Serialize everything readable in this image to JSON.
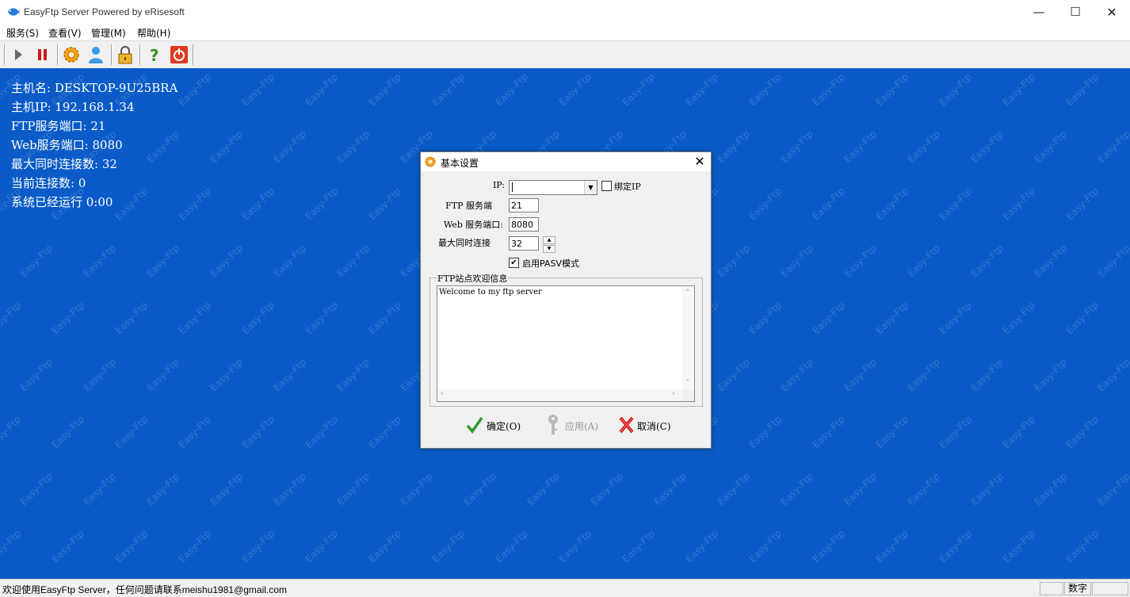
{
  "window": {
    "title": "EasyFtp Server Powered by eRisesoft",
    "min_glyph": "—",
    "max_glyph": "☐",
    "close_glyph": "✕"
  },
  "menu": [
    "服务(S)",
    "查看(V)",
    "管理(M)",
    "帮助(H)"
  ],
  "toolbar": {
    "icons": [
      "play-icon",
      "pause-icon",
      "settings-gear-icon",
      "user-icon",
      "lock-icon",
      "help-icon",
      "power-icon"
    ]
  },
  "server_info": {
    "host": "主机名: DESKTOP-9U25BRA",
    "ip": "主机IP: 192.168.1.34",
    "ftp_port": "FTP服务端口: 21",
    "web_port": "Web服务端口: 8080",
    "max_conn": "最大同时连接数: 32",
    "cur_conn": "当前连接数: 0",
    "uptime": "系统已经运行 0:00"
  },
  "watermark": {
    "text": "Easy-Ftp"
  },
  "dialog": {
    "title": "基本设置",
    "close_glyph": "✕",
    "ip_label": "IP:",
    "ip_value": "",
    "bind_ip_label": "绑定IP",
    "bind_ip_checked": false,
    "ftp_port_label": "FTP 服务端",
    "ftp_port_value": "21",
    "web_port_label": "Web 服务端口:",
    "web_port_value": "8080",
    "max_conn_label": "最大同时连接",
    "max_conn_value": "32",
    "pasv_label": "启用PASV模式",
    "pasv_checked": true,
    "pasv_check_glyph": "✔",
    "welcome_group_label": "FTP站点欢迎信息",
    "welcome_text": "Welcome to my ftp server",
    "ok_label": "确定(O)",
    "apply_label": "应用(A)",
    "cancel_label": "取消(C)"
  },
  "status_bar": {
    "text": "欢迎使用EasyFtp Server，任何问题请联系meishu1981@gmail.com",
    "numlock": "数字"
  },
  "colors": {
    "main_bg": "#0a5bc7",
    "dialog_bg": "#f0f0f0",
    "text_on_blue": "#ffffff"
  }
}
